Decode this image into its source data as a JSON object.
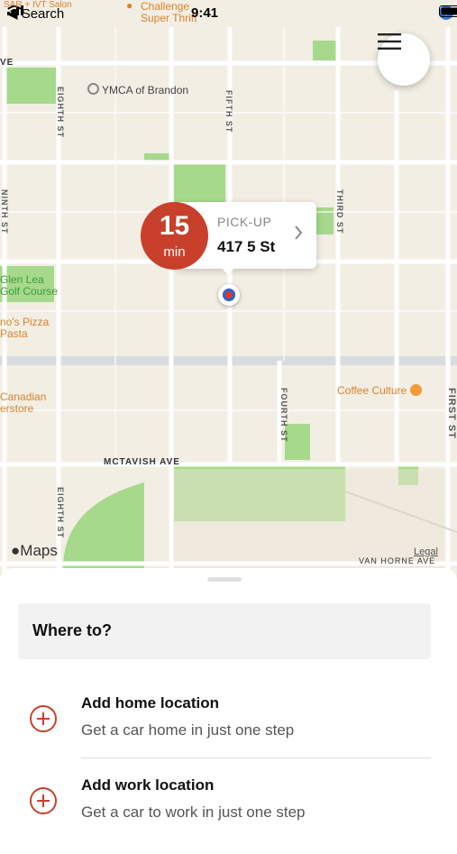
{
  "status_bar": {
    "back_label": "◀ Search",
    "time": "9:41",
    "partial_poi": "Challenge\nSuper Thrift"
  },
  "map": {
    "labels": {
      "ymca": "YMCA of Brandon",
      "glen_lea": "Glen Lea\nGolf Course",
      "pizza": "no's Pizza\nPasta",
      "canadian": "Canadian\nerstore",
      "coffee": "Coffee Culture",
      "partial_top": "SAR + IVT Salon",
      "ve": "VE"
    },
    "streets": {
      "eighth_top": "EIGHTH ST",
      "fifth": "FIFTH ST",
      "ninth": "NINTH ST",
      "third": "THIRD ST",
      "fourth": "FOURTH ST",
      "first": "FIRST ST",
      "eighth_bottom": "EIGHTH ST",
      "mctavish": "MCTAVISH AVE",
      "van_horne": "VAN HORNE AVE"
    },
    "attribution": "Maps",
    "legal": "Legal"
  },
  "pickup": {
    "eta_number": "15",
    "eta_unit": "min",
    "label": "PICK-UP",
    "address": "417 5 St"
  },
  "sheet": {
    "search_placeholder": "Where to?",
    "items": [
      {
        "title": "Add home location",
        "subtitle": "Get a car home in just one step"
      },
      {
        "title": "Add work location",
        "subtitle": "Get a car to work in just one step"
      }
    ]
  },
  "colors": {
    "accent": "#c8402b",
    "park": "#a6d98b",
    "map_bg": "#f2eee4"
  }
}
